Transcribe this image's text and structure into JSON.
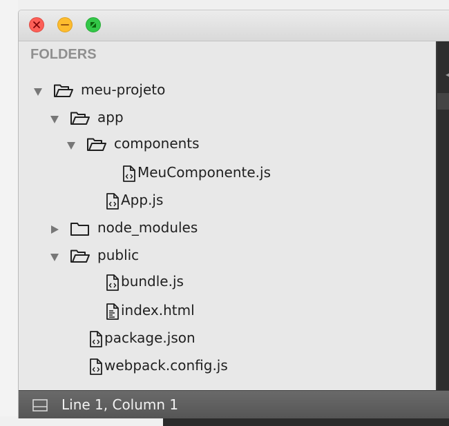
{
  "sidebar": {
    "header": "FOLDERS",
    "tree": [
      {
        "label": "meu-projeto",
        "type": "folder",
        "expanded": true,
        "depth": 0,
        "icon": "folder-open-icon"
      },
      {
        "label": "app",
        "type": "folder",
        "expanded": true,
        "depth": 1,
        "icon": "folder-open-icon"
      },
      {
        "label": "components",
        "type": "folder",
        "expanded": true,
        "depth": 2,
        "icon": "folder-open-icon"
      },
      {
        "label": "MeuComponente.js",
        "type": "file",
        "depth": 3,
        "icon": "file-code-icon"
      },
      {
        "label": "App.js",
        "type": "file",
        "depth": 2,
        "icon": "file-code-icon"
      },
      {
        "label": "node_modules",
        "type": "folder",
        "expanded": false,
        "depth": 1,
        "icon": "folder-closed-icon"
      },
      {
        "label": "public",
        "type": "folder",
        "expanded": true,
        "depth": 1,
        "icon": "folder-open-icon"
      },
      {
        "label": "bundle.js",
        "type": "file",
        "depth": 2,
        "icon": "file-code-icon"
      },
      {
        "label": "index.html",
        "type": "file",
        "depth": 2,
        "icon": "file-text-icon"
      },
      {
        "label": "package.json",
        "type": "file",
        "depth": 1,
        "icon": "file-code-icon"
      },
      {
        "label": "webpack.config.js",
        "type": "file",
        "depth": 1,
        "icon": "file-code-icon"
      }
    ]
  },
  "statusbar": {
    "position_text": "Line 1, Column 1"
  },
  "colors": {
    "close": "#fc5f57",
    "minimize": "#fdbc2e",
    "zoom": "#33c748",
    "sidebar_bg": "#e8e8e8",
    "statusbar_bg": "#5e5e5e"
  }
}
